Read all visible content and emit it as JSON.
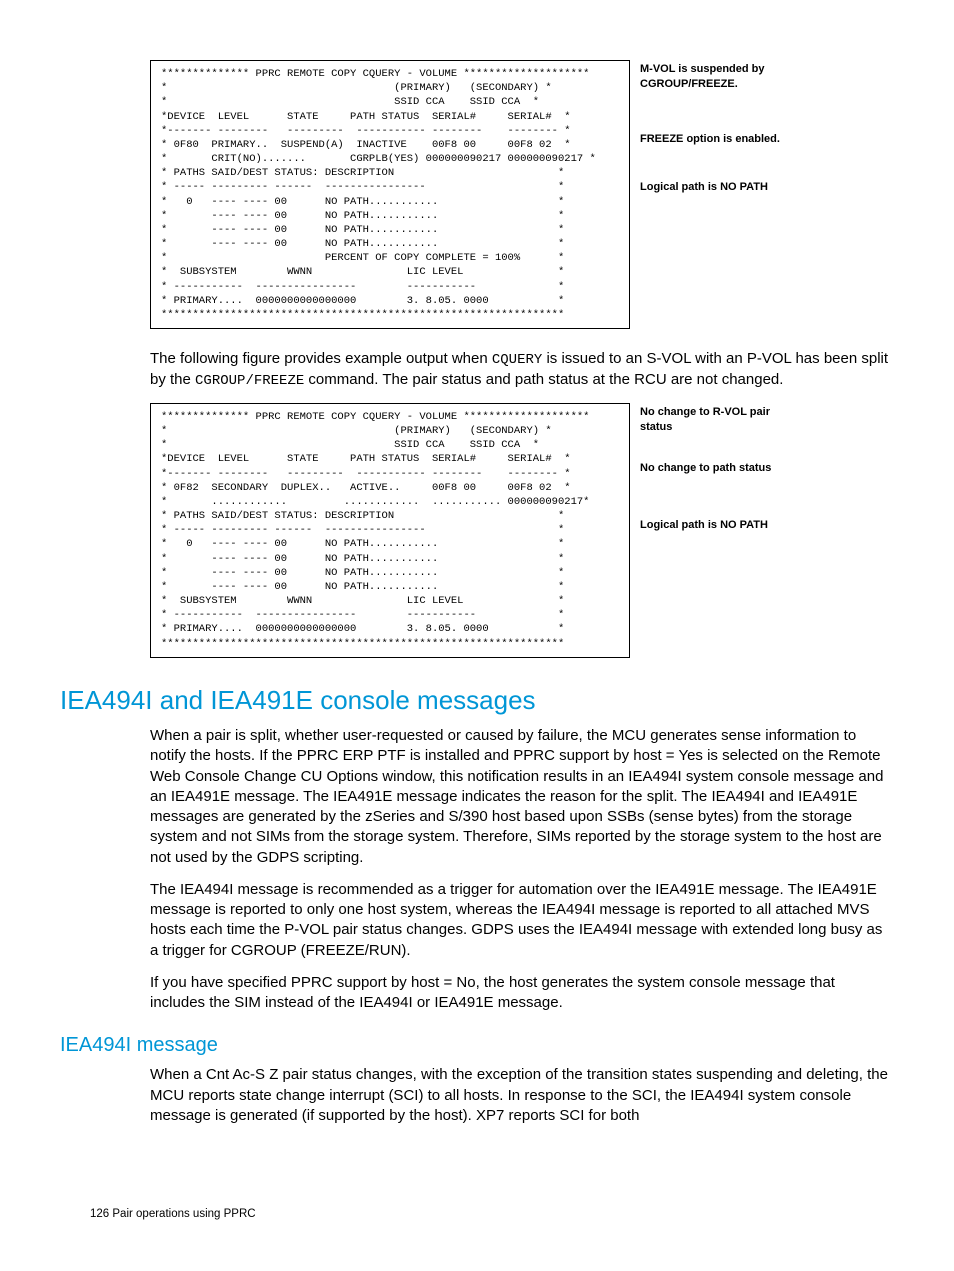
{
  "figure1": {
    "block": "************** PPRC REMOTE COPY CQUERY - VOLUME ********************\n*                                    (PRIMARY)   (SECONDARY) *\n*                                    SSID CCA    SSID CCA  *\n*DEVICE  LEVEL      STATE     PATH STATUS  SERIAL#     SERIAL#  *\n*------- --------   ---------  ----------- --------    -------- *\n* 0F80  PRIMARY..  SUSPEND(A)  INACTIVE    00F8 00     00F8 02  *\n*       CRIT(NO).......       CGRPLB(YES) 000000090217 000000090217 *\n* PATHS SAID/DEST STATUS: DESCRIPTION                          *\n* ----- --------- ------  ----------------                     *\n*   0   ---- ---- 00      NO PATH...........                   *\n*       ---- ---- 00      NO PATH...........                   *\n*       ---- ---- 00      NO PATH...........                   *\n*       ---- ---- 00      NO PATH...........                   *\n*                         PERCENT OF COPY COMPLETE = 100%      *\n*  SUBSYSTEM        WWNN               LIC LEVEL               *\n* -----------  ----------------        -----------             *\n* PRIMARY....  0000000000000000        3. 8.05. 0000           *\n****************************************************************",
    "annot1": "M-VOL is suspended by CGROUP/FREEZE.",
    "annot2": "FREEZE option is enabled.",
    "annot3": "Logical path is NO PATH"
  },
  "para1_a": "The following figure provides example output when ",
  "para1_b": "CQUERY",
  "para1_c": " is issued to an S-VOL with an P-VOL has been split by the ",
  "para1_d": "CGROUP/FREEZE",
  "para1_e": " command. The pair status and path status at the RCU are not changed.",
  "figure2": {
    "block": "************** PPRC REMOTE COPY CQUERY - VOLUME ********************\n*                                    (PRIMARY)   (SECONDARY) *\n*                                    SSID CCA    SSID CCA  *\n*DEVICE  LEVEL      STATE     PATH STATUS  SERIAL#     SERIAL#  *\n*------- --------   ---------  ----------- --------    -------- *\n* 0F82  SECONDARY  DUPLEX..   ACTIVE..     00F8 00     00F8 02  *\n*       ............         ............  ........... 000000090217*\n* PATHS SAID/DEST STATUS: DESCRIPTION                          *\n* ----- --------- ------  ----------------                     *\n*   0   ---- ---- 00      NO PATH...........                   *\n*       ---- ---- 00      NO PATH...........                   *\n*       ---- ---- 00      NO PATH...........                   *\n*       ---- ---- 00      NO PATH...........                   *\n*  SUBSYSTEM        WWNN               LIC LEVEL               *\n* -----------  ----------------        -----------             *\n* PRIMARY....  0000000000000000        3. 8.05. 0000           *\n****************************************************************",
    "annot1": "No change to R-VOL pair status",
    "annot2": "No change to path status",
    "annot3": "Logical path is NO PATH"
  },
  "h2": "IEA494I and IEA491E console messages",
  "p2": "When a pair is split, whether user-requested or caused by failure, the MCU generates sense information to notify the hosts. If the PPRC ERP PTF is installed and PPRC support by host = Yes is selected on the Remote Web Console Change CU Options window, this notification results in an IEA494I system console message and an IEA491E message. The IEA491E message indicates the reason for the split. The IEA494I and IEA491E messages are generated by the zSeries and S/390 host based upon SSBs (sense bytes) from the storage system and not SIMs from the storage system. Therefore, SIMs reported by the storage system to the host are not used by the GDPS scripting.",
  "p3": "The IEA494I message is recommended as a trigger for automation over the IEA491E message. The IEA491E message is reported to only one host system, whereas the IEA494I message is reported to all attached MVS hosts each time the P-VOL pair status changes. GDPS uses the IEA494I message with extended long busy as a trigger for CGROUP (FREEZE/RUN).",
  "p4": "If you have specified PPRC support by host = No, the host generates the system console message that includes the SIM instead of the IEA494I or IEA491E message.",
  "h3": "IEA494I message",
  "p5": "When a Cnt Ac-S Z pair status changes, with the exception of the transition states suspending and deleting, the MCU reports state change interrupt (SCI) to all hosts. In response to the SCI, the IEA494I system console message is generated (if supported by the host). XP7 reports SCI for both",
  "footer": "126    Pair operations using PPRC"
}
